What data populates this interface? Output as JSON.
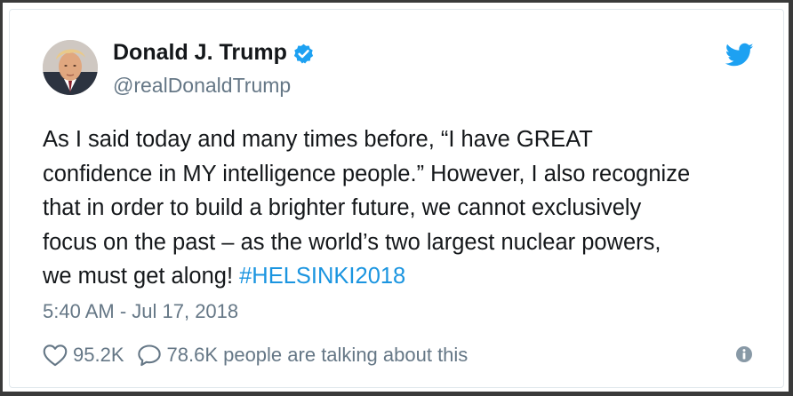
{
  "author": {
    "name": "Donald J. Trump",
    "handle": "@realDonaldTrump",
    "verified": true,
    "avatar_icon": "profile-photo"
  },
  "tweet": {
    "lines": [
      "As I said today and many times before, “I have GREAT",
      "confidence in MY intelligence people.” However, I also recognize",
      "that in order to build a brighter future, we cannot exclusively",
      "focus on the past – as the world’s two largest nuclear powers,",
      "we must get along! "
    ],
    "hashtag": "#HELSINKI2018",
    "timestamp": "5:40 AM - Jul 17, 2018"
  },
  "actions": {
    "like_count": "95.2K",
    "reply_text": "78.6K people are talking about this"
  },
  "icons": {
    "brand": "twitter-bird-icon",
    "verified": "verified-badge-icon",
    "like": "heart-icon",
    "reply": "speech-bubble-icon",
    "info": "info-icon"
  },
  "colors": {
    "brand_blue": "#1da1f2",
    "hashtag_blue": "#1b95e0",
    "text": "#14171a",
    "secondary_text": "#657786",
    "border": "#e1e8ed"
  }
}
